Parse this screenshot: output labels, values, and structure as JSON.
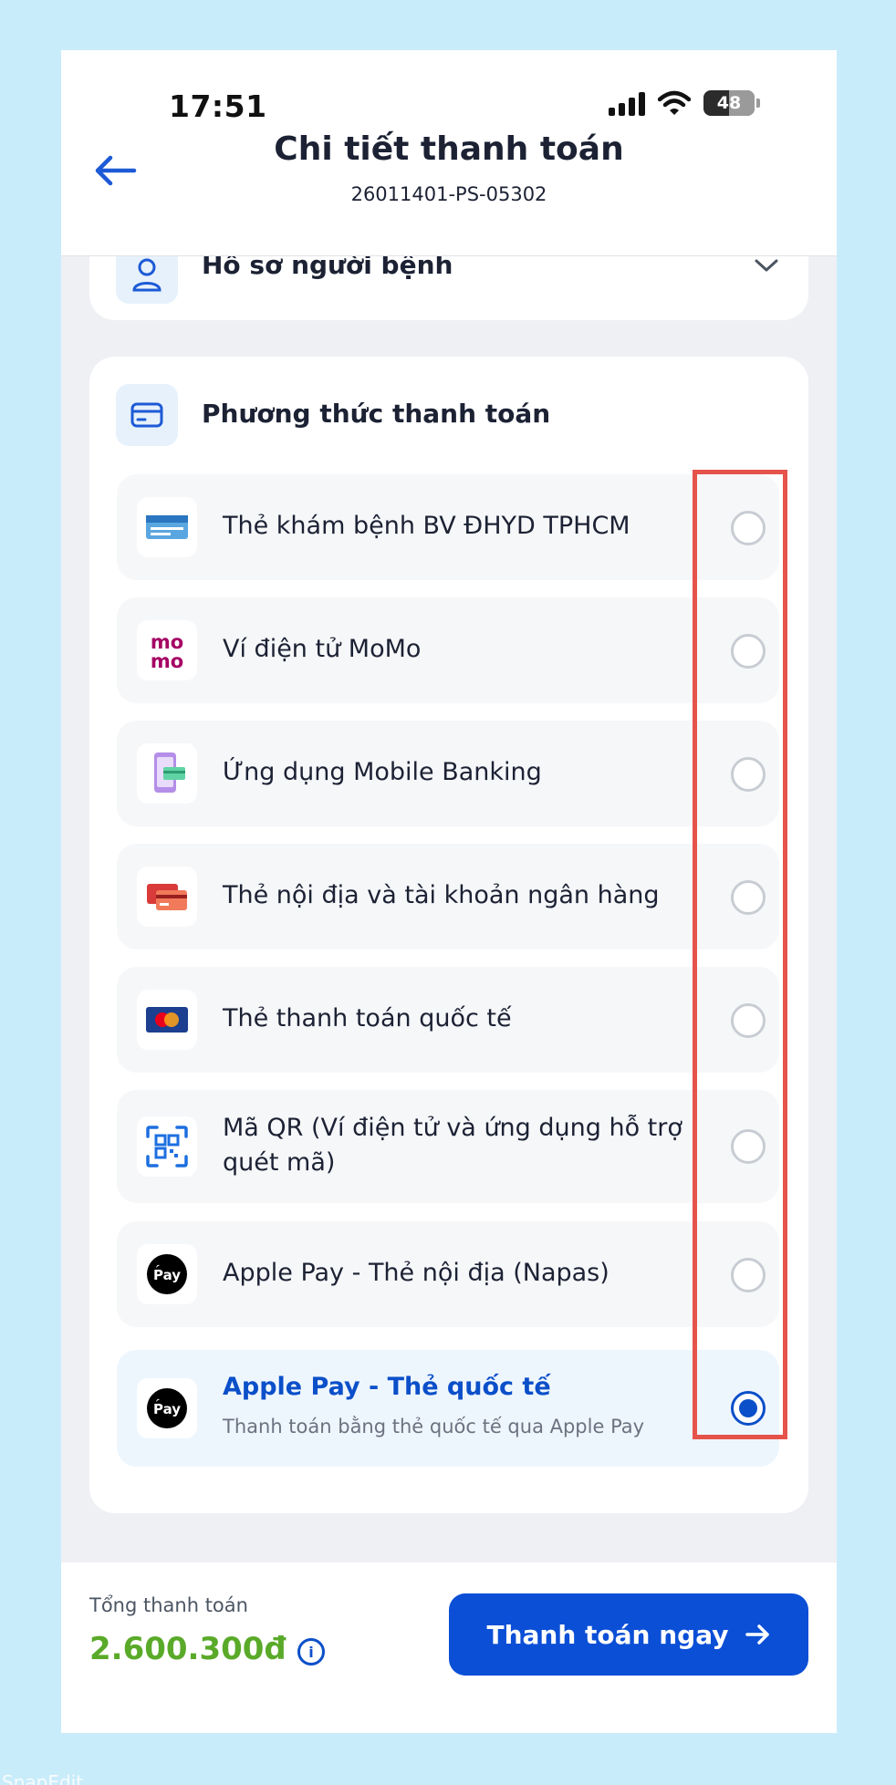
{
  "status_bar": {
    "time": "17:51",
    "battery": "48"
  },
  "header": {
    "title": "Chi tiết thanh toán",
    "subtitle": "26011401-PS-05302"
  },
  "profile_section": {
    "label": "Hồ sơ người bệnh"
  },
  "payment_section": {
    "title": "Phương thức thanh toán",
    "options": [
      {
        "label": "Thẻ khám bệnh BV ĐHYD TPHCM",
        "icon": "hospital-card-icon",
        "selected": false
      },
      {
        "label": "Ví điện tử MoMo",
        "icon": "momo-icon",
        "icon_text": "mo mo",
        "selected": false
      },
      {
        "label": "Ứng dụng Mobile Banking",
        "icon": "mobile-banking-icon",
        "selected": false
      },
      {
        "label": "Thẻ nội địa và tài khoản ngân hàng",
        "icon": "bank-card-icon",
        "selected": false
      },
      {
        "label": "Thẻ thanh toán quốc tế",
        "icon": "mastercard-icon",
        "selected": false
      },
      {
        "label": "Mã QR (Ví điện tử và ứng dụng hỗ trợ quét mã)",
        "icon": "qr-code-icon",
        "selected": false
      },
      {
        "label": "Apple Pay - Thẻ nội địa (Napas)",
        "icon": "apple-pay-icon",
        "icon_text": "Pay",
        "selected": false
      },
      {
        "label": "Apple Pay - Thẻ quốc tế",
        "sublabel": "Thanh toán bằng thẻ quốc tế qua Apple Pay",
        "icon": "apple-pay-icon",
        "icon_text": "Pay",
        "selected": true
      }
    ]
  },
  "footer": {
    "total_label": "Tổng thanh toán",
    "total_amount": "2.600.300đ",
    "pay_button": "Thanh toán ngay"
  },
  "watermark": "SnapEdit",
  "colors": {
    "accent": "#0b4fd6",
    "amount": "#5aaa2a",
    "highlight": "#e5534b",
    "background": "#c9ecfb"
  }
}
